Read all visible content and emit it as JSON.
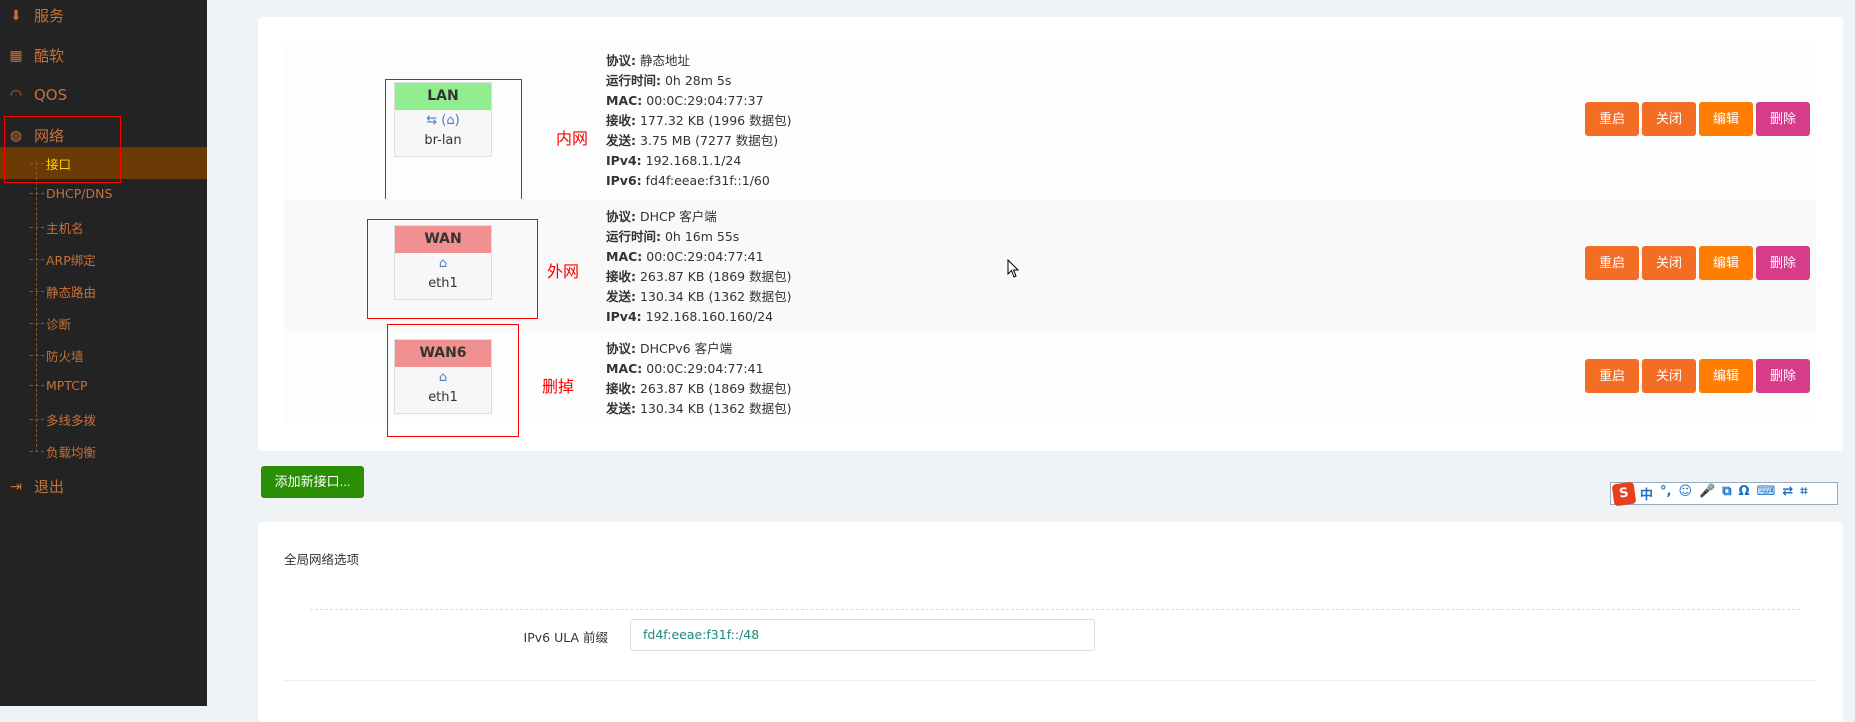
{
  "sidebar": {
    "items": [
      {
        "label": "服务",
        "icon": "download-icon"
      },
      {
        "label": "酷软",
        "icon": "calendar-icon"
      },
      {
        "label": "QOS",
        "icon": "gauge-icon"
      },
      {
        "label": "网络",
        "icon": "globe-icon"
      }
    ],
    "sub_items": [
      "接口",
      "DHCP/DNS",
      "主机名",
      "ARP绑定",
      "静态路由",
      "诊断",
      "防火墙",
      "MPTCP",
      "多线多拨",
      "负载均衡"
    ],
    "active": "接口",
    "logout": "退出"
  },
  "interfaces": [
    {
      "name": "LAN",
      "color": "#90ee90",
      "device": "br-lan",
      "annotation": "内网",
      "info": [
        [
          "协议:",
          "静态地址"
        ],
        [
          "运行时间:",
          "0h 28m 5s"
        ],
        [
          "MAC:",
          "00:0C:29:04:77:37"
        ],
        [
          "接收:",
          "177.32 KB (1996 数据包)"
        ],
        [
          "发送:",
          "3.75 MB (7277 数据包)"
        ],
        [
          "IPv4:",
          "192.168.1.1/24"
        ],
        [
          "IPv6:",
          "fd4f:eeae:f31f::1/60"
        ]
      ]
    },
    {
      "name": "WAN",
      "color": "#f09090",
      "device": "eth1",
      "annotation": "外网",
      "info": [
        [
          "协议:",
          "DHCP 客户端"
        ],
        [
          "运行时间:",
          "0h 16m 55s"
        ],
        [
          "MAC:",
          "00:0C:29:04:77:41"
        ],
        [
          "接收:",
          "263.87 KB (1869 数据包)"
        ],
        [
          "发送:",
          "130.34 KB (1362 数据包)"
        ],
        [
          "IPv4:",
          "192.168.160.160/24"
        ]
      ]
    },
    {
      "name": "WAN6",
      "color": "#f09090",
      "device": "eth1",
      "annotation": "删掉",
      "info": [
        [
          "协议:",
          "DHCPv6 客户端"
        ],
        [
          "MAC:",
          "00:0C:29:04:77:41"
        ],
        [
          "接收:",
          "263.87 KB (1869 数据包)"
        ],
        [
          "发送:",
          "130.34 KB (1362 数据包)"
        ]
      ]
    }
  ],
  "row_buttons": {
    "restart": "重启",
    "stop": "关闭",
    "edit": "编辑",
    "delete": "删除"
  },
  "colors": {
    "restart": "#f46d25",
    "stop": "#f46d25",
    "edit": "#ff7d00",
    "delete": "#d63c8a",
    "add": "#2a8f05"
  },
  "add_button": "添加新接口...",
  "global": {
    "title": "全局网络选项",
    "ula_label": "IPv6 ULA 前缀",
    "ula_value": "fd4f:eeae:f31f::/48"
  },
  "ime": {
    "items": [
      "中",
      "°,",
      "☺",
      "🎤",
      "⧉",
      "Ω",
      "⌨",
      "⇄",
      "⌗"
    ]
  }
}
